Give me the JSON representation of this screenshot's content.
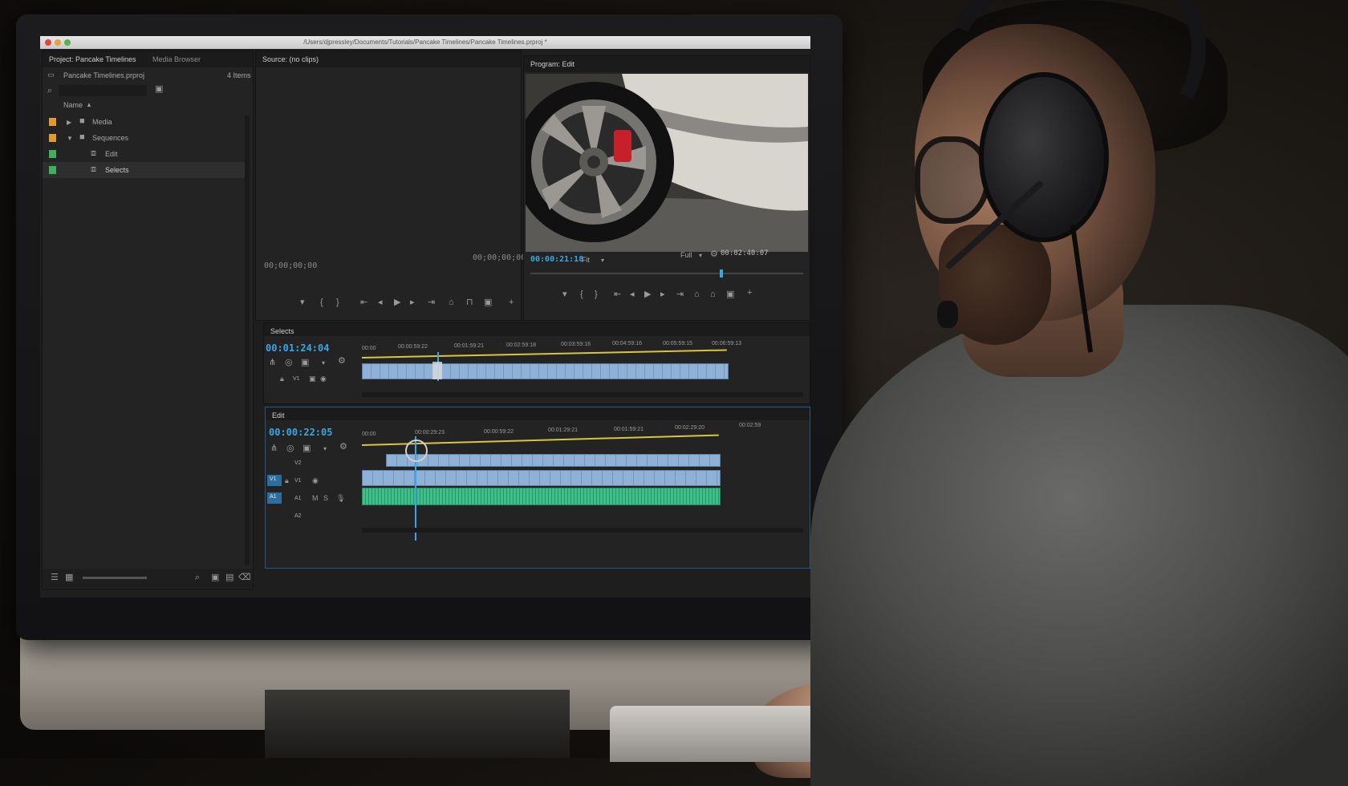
{
  "window": {
    "path": "/Users/djpressley/Documents/Tutorials/Pancake Timelines/Pancake Timelines.prproj *"
  },
  "project_panel": {
    "tab_active": "Project: Pancake Timelines",
    "tab_other": "Media Browser",
    "file_name": "Pancake Timelines.prproj",
    "item_count": "4 Items",
    "column_name": "Name",
    "items": [
      {
        "label": "Media",
        "color": "#e39a2c",
        "type": "folder",
        "expanded": false
      },
      {
        "label": "Sequences",
        "color": "#e39a2c",
        "type": "folder",
        "expanded": true
      },
      {
        "label": "Edit",
        "color": "#3fae5f",
        "type": "sequence"
      },
      {
        "label": "Selects",
        "color": "#3fae5f",
        "type": "sequence"
      }
    ]
  },
  "source_panel": {
    "tab": "Source: (no clips)",
    "timecode_left": "00;00;00;00",
    "timecode_right": "00;00;00;00"
  },
  "program_panel": {
    "tab": "Program: Edit",
    "timecode_left": "00:00:21:18",
    "fit_label": "Fit",
    "quality_label": "Full",
    "timecode_right": "00:02:40:07"
  },
  "selects_timeline": {
    "tab": "Selects",
    "timecode": "00:01:24:04",
    "ruler": [
      "00:00",
      "00:00:59:22",
      "00:01:59:21",
      "00:02:59:18",
      "00:03:59:16",
      "00:04:59:16",
      "00:05:59:15",
      "00:06:59:13"
    ],
    "track_labels": [
      "V1"
    ]
  },
  "edit_timeline": {
    "tab": "Edit",
    "timecode": "00:00:22:05",
    "ruler": [
      "00:00",
      "00:00:29:23",
      "00:00:59:22",
      "00:01:29:21",
      "00:01:59:21",
      "00:02:29:20",
      "00:02:59"
    ],
    "track_labels": [
      "V2",
      "V1",
      "A1",
      "A2"
    ],
    "src_labels": [
      "V1",
      "A1"
    ]
  },
  "colors": {
    "accent_timecode": "#3aa6e8",
    "video_clip": "#8fb1d6",
    "audio_clip": "#3fbf8c",
    "work_area": "#d7c542"
  },
  "icons": [
    "search-icon",
    "new-bin-icon",
    "folder-icon",
    "sequence-icon",
    "play-icon",
    "step-back-icon",
    "step-forward-icon",
    "mark-in-icon",
    "mark-out-icon",
    "wrench-icon",
    "camera-icon",
    "zoom-icon"
  ]
}
